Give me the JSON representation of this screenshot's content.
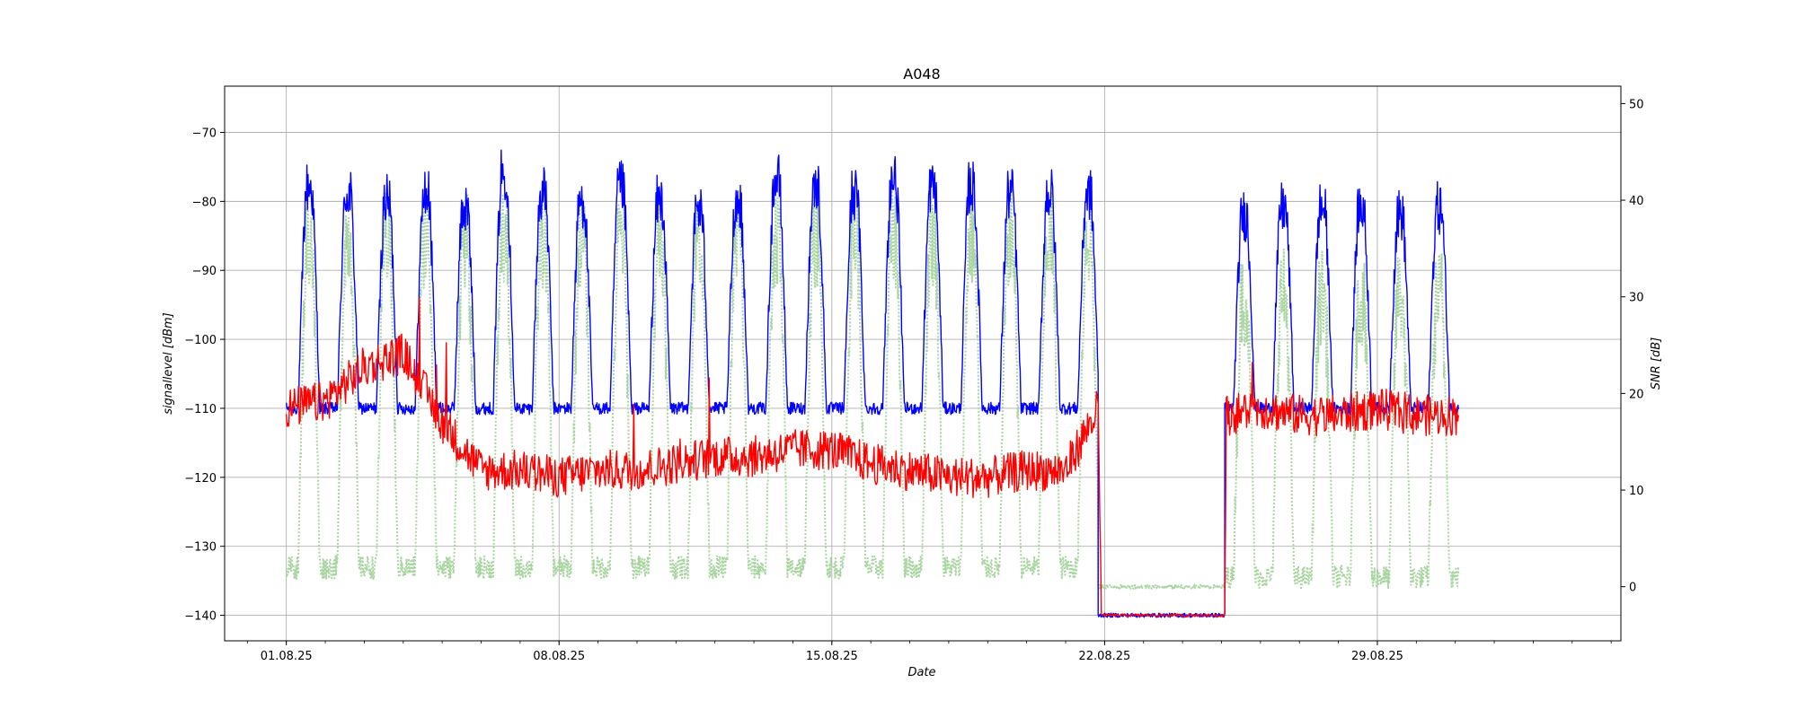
{
  "chart_data": {
    "type": "line",
    "title": "A048",
    "xlabel": "Date",
    "ylabel_left": "signallevel [dBm]",
    "ylabel_right": "SNR [dB]",
    "x_ticks": [
      "01.08.25",
      "08.08.25",
      "15.08.25",
      "22.08.25",
      "29.08.25"
    ],
    "x_range": [
      "2025-07-30T10:00",
      "2025-09-04T06:00"
    ],
    "ylim_left": [
      -143.7,
      -63.3
    ],
    "ylim_right": [
      -5.6,
      51.8
    ],
    "yticks_left": [
      -70,
      -80,
      -90,
      -100,
      -110,
      -120,
      -130,
      -140
    ],
    "yticks_right": [
      50,
      40,
      30,
      20,
      10,
      0
    ],
    "grid": true,
    "series": [
      {
        "color": "#0000ff",
        "axis": "left",
        "style": "solid",
        "description": "signal level, daily cycle",
        "segments": [
          {
            "start": "2025-08-01T00:00",
            "end": "2025-08-21T20:00",
            "day_peak_dbm": [
              -78,
              -79,
              -80,
              -79,
              -81,
              -76,
              -79,
              -80,
              -78,
              -80,
              -81,
              -80,
              -77,
              -78,
              -79,
              -77,
              -78,
              -78,
              -79,
              -79,
              -79
            ],
            "night_low_dbm": -110
          },
          {
            "start": "2025-08-21T20:00",
            "end": "2025-08-25T02:00",
            "level_dbm": -140
          },
          {
            "start": "2025-08-25T02:00",
            "end": "2025-08-31T02:00",
            "day_peak_dbm": [
              -82,
              -81,
              -81,
              -81,
              -82,
              -81
            ],
            "night_low_dbm": -110
          }
        ]
      },
      {
        "color": "#ff0000",
        "axis": "left",
        "style": "solid",
        "description": "noise level",
        "points": [
          [
            "2025-08-01T00:00",
            -110
          ],
          [
            "2025-08-02T00:00",
            -109
          ],
          [
            "2025-08-03T00:00",
            -104
          ],
          [
            "2025-08-04T00:00",
            -102
          ],
          [
            "2025-08-05T00:00",
            -112
          ],
          [
            "2025-08-06T00:00",
            -119
          ],
          [
            "2025-08-07T00:00",
            -119
          ],
          [
            "2025-08-08T00:00",
            -120
          ],
          [
            "2025-08-09T00:00",
            -119
          ],
          [
            "2025-08-10T00:00",
            -119
          ],
          [
            "2025-08-11T00:00",
            -118
          ],
          [
            "2025-08-12T00:00",
            -117
          ],
          [
            "2025-08-13T00:00",
            -117
          ],
          [
            "2025-08-14T00:00",
            -116
          ],
          [
            "2025-08-15T00:00",
            -116
          ],
          [
            "2025-08-16T00:00",
            -118
          ],
          [
            "2025-08-17T00:00",
            -119
          ],
          [
            "2025-08-18T00:00",
            -120
          ],
          [
            "2025-08-19T00:00",
            -120
          ],
          [
            "2025-08-20T00:00",
            -119
          ],
          [
            "2025-08-21T00:00",
            -119
          ],
          [
            "2025-08-21T20:00",
            -110
          ],
          [
            "2025-08-21T22:00",
            -140
          ],
          [
            "2025-08-25T02:00",
            -140
          ],
          [
            "2025-08-25T03:00",
            -111
          ],
          [
            "2025-08-26T00:00",
            -110
          ],
          [
            "2025-08-27T00:00",
            -111
          ],
          [
            "2025-08-28T00:00",
            -111
          ],
          [
            "2025-08-29T00:00",
            -110
          ],
          [
            "2025-08-30T00:00",
            -111
          ],
          [
            "2025-08-31T02:00",
            -111
          ]
        ]
      },
      {
        "color": "#a8d4a0",
        "axis": "right",
        "style": "dotted",
        "description": "SNR, daily cycle",
        "segments": [
          {
            "start": "2025-08-01T00:00",
            "end": "2025-08-21T20:00",
            "day_peak_db": 36,
            "night_low_db": 2
          },
          {
            "start": "2025-08-21T20:00",
            "end": "2025-08-25T02:00",
            "level_db": 0
          },
          {
            "start": "2025-08-25T02:00",
            "end": "2025-08-31T02:00",
            "day_peak_db": 30,
            "night_low_db": 1
          }
        ]
      }
    ]
  }
}
